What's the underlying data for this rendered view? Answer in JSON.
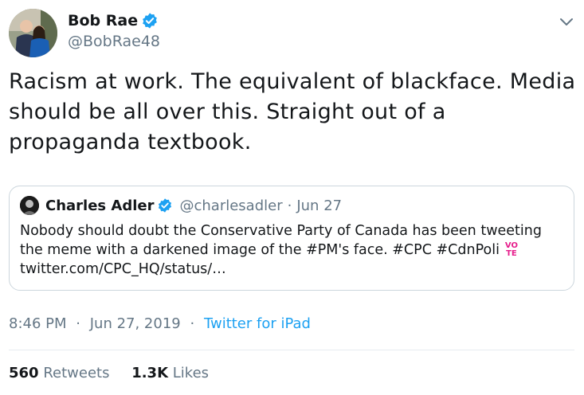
{
  "author": {
    "display_name": "Bob Rae",
    "handle": "@BobRae48"
  },
  "tweet": {
    "text": "Racism at work.  The equivalent of blackface.  Media should be all over this.  Straight out of a propaganda textbook."
  },
  "quote": {
    "display_name": "Charles Adler",
    "handle": "@charlesadler",
    "separator": "·",
    "date": "Jun 27",
    "body_text": "Nobody should doubt the Conservative Party of Canada has been tweeting the meme with a darkened image of the #PM's face. #CPC #CdnPoli",
    "emoji_line1": "VO",
    "emoji_line2": "TE",
    "link": "twitter.com/CPC_HQ/status/…"
  },
  "meta": {
    "time": "8:46 PM",
    "separator": "·",
    "date": "Jun 27, 2019",
    "source": "Twitter for iPad"
  },
  "stats": {
    "retweets_count": "560",
    "retweets_label": "Retweets",
    "likes_count": "1.3K",
    "likes_label": "Likes"
  },
  "colors": {
    "verified": "#1da1f2",
    "link": "#1da1f2",
    "muted": "#657786",
    "border": "#ccd6dd"
  }
}
